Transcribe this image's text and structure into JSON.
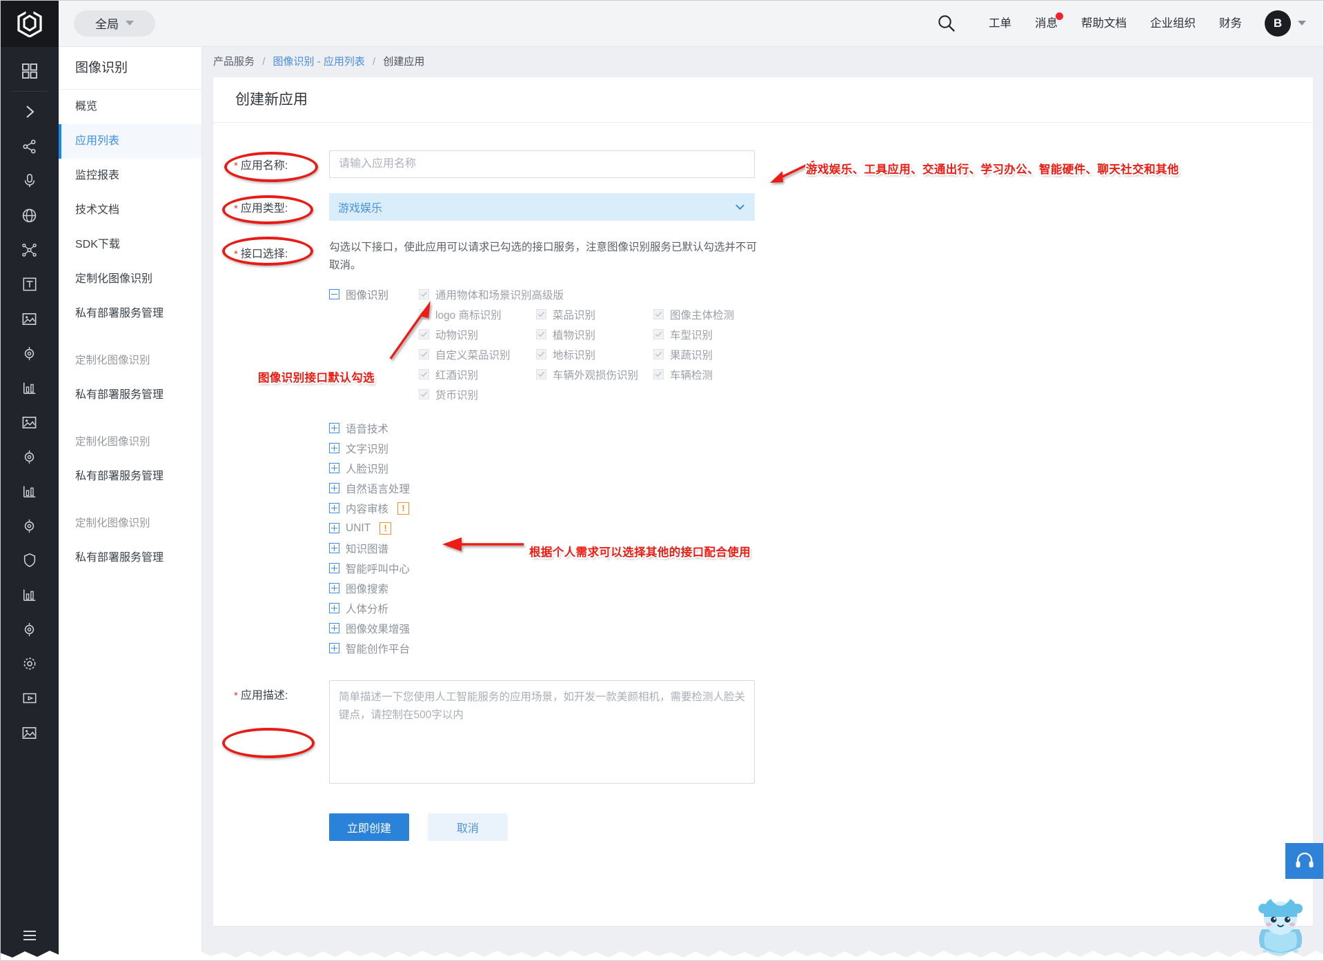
{
  "topbar": {
    "scope_label": "全局",
    "search_icon": "search-icon",
    "links": [
      {
        "label": "工单",
        "badge": false
      },
      {
        "label": "消息",
        "badge": true
      },
      {
        "label": "帮助文档",
        "badge": false
      },
      {
        "label": "企业组织",
        "badge": false
      },
      {
        "label": "财务",
        "badge": false
      }
    ],
    "avatar_initial": "B"
  },
  "sidebar": {
    "title": "图像识别",
    "items": [
      {
        "label": "概览",
        "active": false,
        "ghost": false
      },
      {
        "label": "应用列表",
        "active": true,
        "ghost": false
      },
      {
        "label": "监控报表",
        "active": false,
        "ghost": false
      },
      {
        "label": "技术文档",
        "active": false,
        "ghost": false
      },
      {
        "label": "SDK下载",
        "active": false,
        "ghost": false
      },
      {
        "label": "定制化图像识别",
        "active": false,
        "ghost": false
      },
      {
        "label": "私有部署服务管理",
        "active": false,
        "ghost": false
      },
      {
        "label": "定制化图像识别",
        "active": false,
        "ghost": true
      },
      {
        "label": "私有部署服务管理",
        "active": false,
        "ghost": false
      },
      {
        "label": "定制化图像识别",
        "active": false,
        "ghost": true
      },
      {
        "label": "私有部署服务管理",
        "active": false,
        "ghost": false
      },
      {
        "label": "定制化图像识别",
        "active": false,
        "ghost": true
      },
      {
        "label": "私有部署服务管理",
        "active": false,
        "ghost": false
      }
    ]
  },
  "breadcrumb": {
    "root": "产品服务",
    "mid": "图像识别 - 应用列表",
    "current": "创建应用",
    "separator": "/"
  },
  "page": {
    "card_title": "创建新应用"
  },
  "form": {
    "name": {
      "label": "应用名称:",
      "required_mark": "*",
      "placeholder": "请输入应用名称",
      "value": ""
    },
    "type": {
      "label": "应用类型:",
      "required_mark": "*",
      "selected": "游戏娱乐",
      "options": [
        "游戏娱乐",
        "工具应用",
        "交通出行",
        "学习办公",
        "智能硬件",
        "聊天社交",
        "其他"
      ]
    },
    "interfaces": {
      "label": "接口选择:",
      "required_mark": "*",
      "hint": "勾选以下接口，使此应用可以请求已勾选的接口服务，注意图像识别服务已默认勾选并不可取消。",
      "expanded_group": {
        "name": "图像识别",
        "toggle": "minus",
        "checkboxes": [
          {
            "label": "通用物体和场景识别高级版",
            "checked": true,
            "disabled": true,
            "wide": true
          },
          {
            "label": "logo 商标识别",
            "checked": true,
            "disabled": true
          },
          {
            "label": "菜品识别",
            "checked": true,
            "disabled": true
          },
          {
            "label": "图像主体检测",
            "checked": true,
            "disabled": true
          },
          {
            "label": "动物识别",
            "checked": true,
            "disabled": true
          },
          {
            "label": "植物识别",
            "checked": true,
            "disabled": true
          },
          {
            "label": "车型识别",
            "checked": true,
            "disabled": true
          },
          {
            "label": "自定义菜品识别",
            "checked": true,
            "disabled": true
          },
          {
            "label": "地标识别",
            "checked": true,
            "disabled": true
          },
          {
            "label": "果蔬识别",
            "checked": true,
            "disabled": true
          },
          {
            "label": "红酒识别",
            "checked": true,
            "disabled": true
          },
          {
            "label": "车辆外观损伤识别",
            "checked": true,
            "disabled": true
          },
          {
            "label": "车辆检测",
            "checked": true,
            "disabled": true
          },
          {
            "label": "货币识别",
            "checked": true,
            "disabled": true
          }
        ]
      },
      "collapsed_groups": [
        {
          "label": "语音技术",
          "toggle": "plus",
          "warn": false
        },
        {
          "label": "文字识别",
          "toggle": "plus",
          "warn": false
        },
        {
          "label": "人脸识别",
          "toggle": "plus",
          "warn": false
        },
        {
          "label": "自然语言处理",
          "toggle": "plus",
          "warn": false
        },
        {
          "label": "内容审核",
          "toggle": "plus",
          "warn": true
        },
        {
          "label": "UNIT",
          "toggle": "plus",
          "warn": true
        },
        {
          "label": "知识图谱",
          "toggle": "plus",
          "warn": false
        },
        {
          "label": "智能呼叫中心",
          "toggle": "plus",
          "warn": false
        },
        {
          "label": "图像搜索",
          "toggle": "plus",
          "warn": false
        },
        {
          "label": "人体分析",
          "toggle": "plus",
          "warn": false
        },
        {
          "label": "图像效果增强",
          "toggle": "plus",
          "warn": false
        },
        {
          "label": "智能创作平台",
          "toggle": "plus",
          "warn": false
        }
      ],
      "warn_glyph": "!"
    },
    "description": {
      "label": "应用描述:",
      "required_mark": "*",
      "placeholder": "简单描述一下您使用人工智能服务的应用场景，如开发一款美颜相机，需要检测人脸关键点，请控制在500字以内",
      "value": ""
    },
    "submit_label": "立即创建",
    "cancel_label": "取消"
  },
  "annotations": [
    {
      "id": "anno-app-name",
      "kind": "ellipse"
    },
    {
      "id": "anno-app-type",
      "kind": "ellipse"
    },
    {
      "id": "anno-interface",
      "kind": "ellipse"
    },
    {
      "id": "anno-app-desc",
      "kind": "ellipse"
    },
    {
      "id": "anno-types-text",
      "kind": "text",
      "text": "游戏娱乐、工具应用、交通出行、学习办公、智能硬件、聊天社交和其他"
    },
    {
      "id": "anno-default-checked-text",
      "kind": "text",
      "text": "图像识别接口默认勾选"
    },
    {
      "id": "anno-optional-text",
      "kind": "text",
      "text": "根据个人需求可以选择其他的接口配合使用"
    }
  ],
  "colors": {
    "accent": "#2b82d9",
    "link": "#4a8ddc",
    "annotation_red": "#ee1b12",
    "badge_red": "#f5222d",
    "warn_orange": "#f0921f",
    "rail_dark": "#22242b",
    "select_bg": "#daedfb"
  },
  "widgets": {
    "support_icon": "headset-icon",
    "mascot": "mascot-icon"
  }
}
